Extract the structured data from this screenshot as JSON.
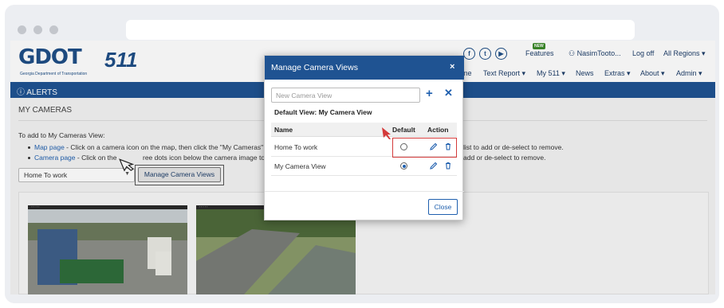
{
  "header": {
    "logo_text": "GDOT",
    "logo_subtitle": "Georgia Department of Transportation",
    "logo_511": "511",
    "social": [
      "f",
      "t",
      "▶"
    ],
    "new_badge": "NEW",
    "features": "Features",
    "user": "NasimTooto...",
    "logoff": "Log off",
    "regions": "All Regions ▾"
  },
  "nav": {
    "items": [
      "me",
      "Text Report ▾",
      "My 511 ▾",
      "News",
      "Extras ▾",
      "About ▾",
      "Admin ▾"
    ]
  },
  "alerts": {
    "label": "ALERTS"
  },
  "page": {
    "title": "MY CAMERAS",
    "instructions": "To add to My Cameras View:",
    "map_link": "Map page",
    "map_text": " - Click on a camera icon on the map, then click the \"My Cameras\"",
    "map_text_tail": "list to add or de-select to remove.",
    "camera_link": "Camera page",
    "camera_text": " - Click on the",
    "camera_text_mid": "ree dots icon below the camera image to ac",
    "camera_text_tail": "add or de-select to remove.",
    "selected_view": "Home To work",
    "manage_button": "Manage Camera Views"
  },
  "modal": {
    "title": "Manage Camera Views",
    "close_x": "×",
    "input_placeholder": "New Camera View",
    "input_value": "",
    "default_view_label": "Default View: My Camera View",
    "col_name": "Name",
    "col_default": "Default",
    "col_action": "Action",
    "rows": [
      {
        "name": "Home To work",
        "default": false
      },
      {
        "name": "My Camera View",
        "default": true
      }
    ],
    "close_button": "Close"
  },
  "colors": {
    "brand_blue": "#1f5392",
    "link_blue": "#1f5fae",
    "highlight_red": "#d43a3a"
  }
}
